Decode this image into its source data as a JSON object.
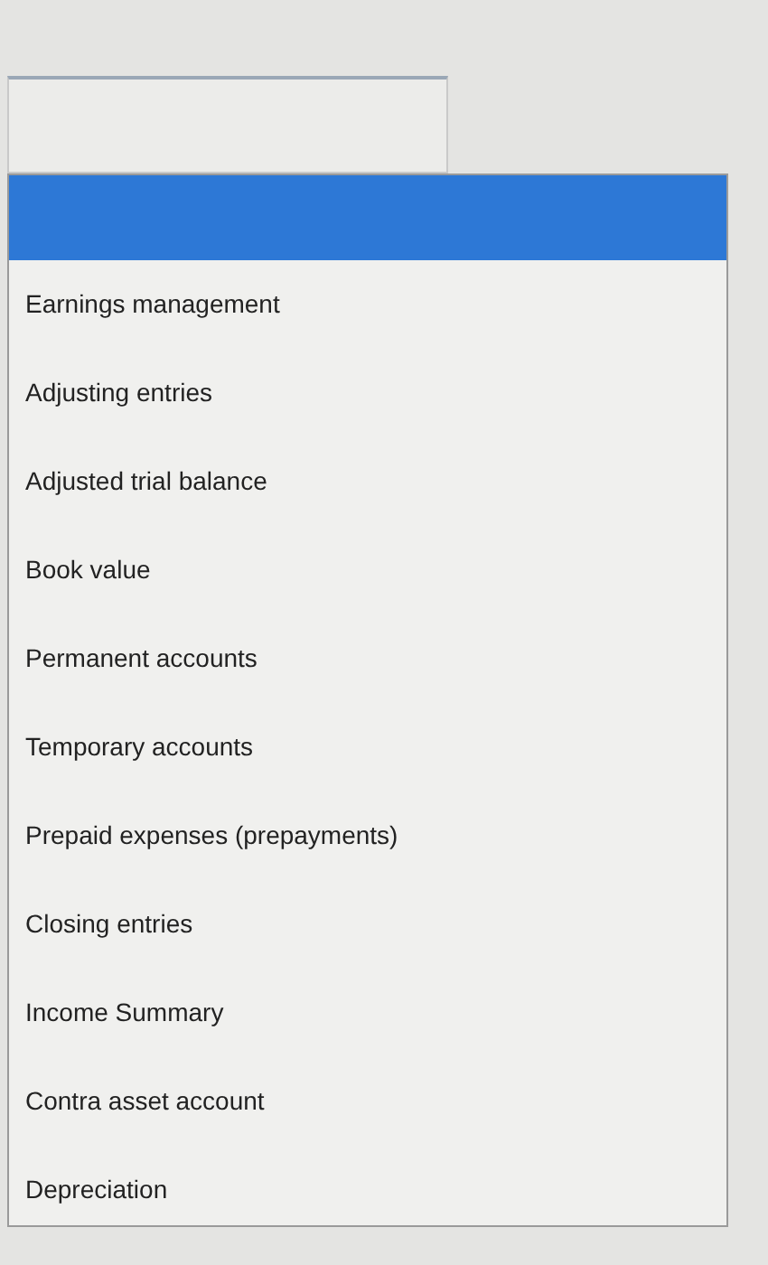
{
  "dropdown": {
    "options": [
      {
        "kind": "blank",
        "selected": true
      },
      {
        "kind": "text",
        "label": "Earnings management",
        "selected": false
      },
      {
        "kind": "text",
        "label": "Adjusting entries",
        "selected": false
      },
      {
        "kind": "text",
        "label": "Adjusted trial balance",
        "selected": false
      },
      {
        "kind": "text",
        "label": "Book value",
        "selected": false
      },
      {
        "kind": "text",
        "label": "Permanent accounts",
        "selected": false
      },
      {
        "kind": "text",
        "label": "Temporary accounts",
        "selected": false
      },
      {
        "kind": "text",
        "label": "Prepaid expenses (prepayments)",
        "selected": false
      },
      {
        "kind": "text",
        "label": "Closing entries",
        "selected": false
      },
      {
        "kind": "text",
        "label": "Income Summary",
        "selected": false
      },
      {
        "kind": "text",
        "label": "Contra asset account",
        "selected": false
      },
      {
        "kind": "text",
        "label": "Depreciation",
        "selected": false
      }
    ]
  }
}
